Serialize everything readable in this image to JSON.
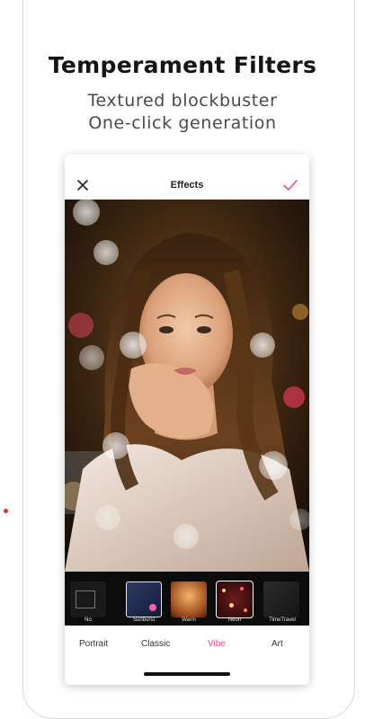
{
  "header": {
    "title": "Temperament Filters",
    "subtitle_line1": "Textured blockbuster",
    "subtitle_line2": "One-click generation"
  },
  "editor": {
    "title": "Effects",
    "close_icon": "close-icon",
    "confirm_icon": "check-icon",
    "accent_color": "#f2478e"
  },
  "filters": [
    {
      "label": "No",
      "selected": false
    },
    {
      "label": "Sunburst",
      "selected": false
    },
    {
      "label": "Warm",
      "selected": false
    },
    {
      "label": "Neon",
      "selected": true
    },
    {
      "label": "TimeTravel",
      "selected": false
    }
  ],
  "tabs": [
    {
      "label": "Portrait",
      "active": false
    },
    {
      "label": "Classic",
      "active": false
    },
    {
      "label": "Vibe",
      "active": true
    },
    {
      "label": "Art",
      "active": false
    }
  ]
}
